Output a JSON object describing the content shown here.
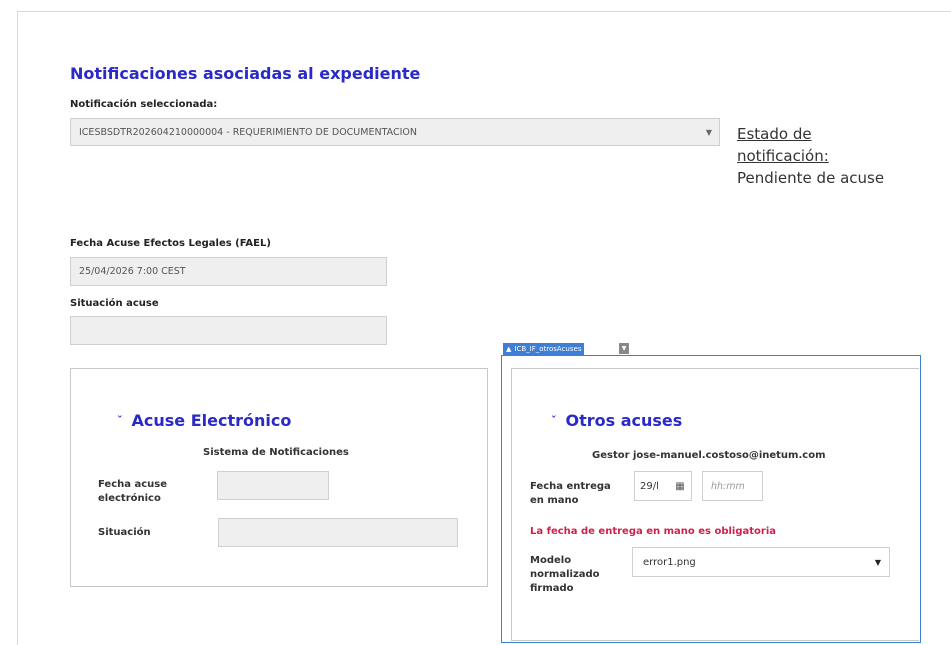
{
  "header": {
    "title": "Notificaciones asociadas al expediente"
  },
  "notificacion": {
    "label": "Notificación seleccionada:",
    "value": "ICESBSDTR202604210000004 - REQUERIMIENTO DE DOCUMENTACION",
    "caret_icon": "chevron-down-icon"
  },
  "estado": {
    "label": "Estado de notificación:",
    "value": "Pendiente de acuse"
  },
  "fael": {
    "label": "Fecha Acuse Efectos Legales (FAEL)",
    "value": "25/04/2026 7:00 CEST"
  },
  "situacion_acuse": {
    "label": "Situación acuse",
    "value": ""
  },
  "acuse_electronico": {
    "title": "Acuse Electrónico",
    "subtitle": "Sistema de Notificaciones",
    "fecha_label": "Fecha acuse electrónico",
    "fecha_value": "",
    "situacion_label": "Situación",
    "situacion_value": ""
  },
  "component_badge": {
    "label": "ICB_IF_otrosAcuses",
    "icon": "sitemap-icon",
    "button_icon": "caret-down-icon"
  },
  "otros_acuses": {
    "title": "Otros acuses",
    "gestor": "Gestor jose-manuel.costoso@inetum.com",
    "fecha_label": "Fecha entrega en mano",
    "fecha_value": "29/l",
    "fecha_icon": "calendar-icon",
    "hora_placeholder": "hh:mm",
    "error": "La fecha de entrega en mano es obligatoria",
    "modelo_label": "Modelo normalizado firmado",
    "modelo_value": "error1.png"
  },
  "colors": {
    "title_blue": "#2a2ac8",
    "badge_blue": "#3d7fd6",
    "error_red": "#d02050"
  }
}
